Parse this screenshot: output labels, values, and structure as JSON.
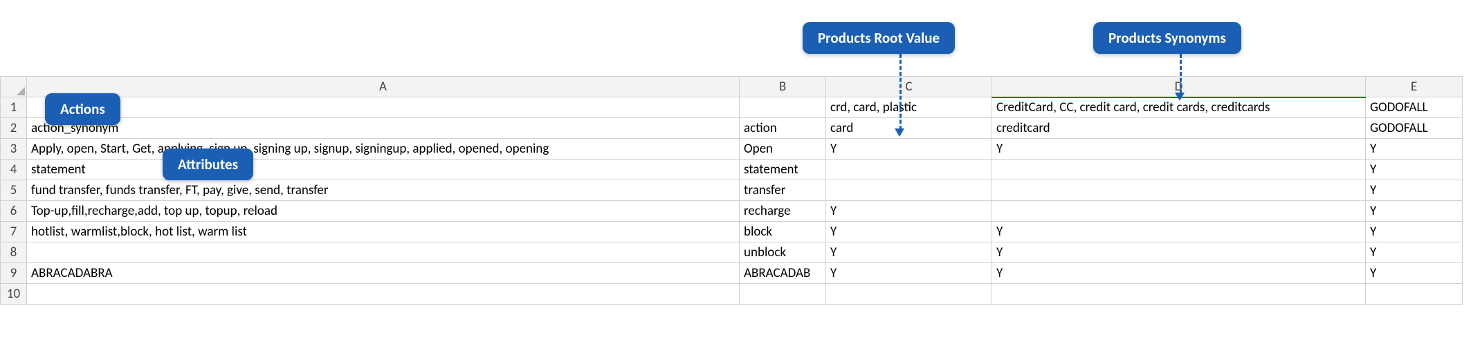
{
  "callouts": {
    "root": "Products Root Value",
    "synonyms": "Products Synonyms",
    "actions": "Actions",
    "attributes": "Attributes"
  },
  "columns": [
    "",
    "A",
    "B",
    "C",
    "D",
    "E"
  ],
  "row_labels": [
    "1",
    "2",
    "3",
    "4",
    "5",
    "6",
    "7",
    "8",
    "9",
    "10"
  ],
  "rows": [
    {
      "A": "",
      "B": "",
      "C": "crd, card, plastic",
      "D": "CreditCard, CC, credit card, credit cards, creditcards",
      "E": "GODOFALL"
    },
    {
      "A": "action_synonym",
      "B": "action",
      "C": "card",
      "D": "creditcard",
      "E": "GODOFALL"
    },
    {
      "A": "Apply, open,  Start, Get, applying, sign up, signing up, signup, signingup, applied, opened, opening",
      "B": "Open",
      "C": "Y",
      "D": "Y",
      "E": "Y"
    },
    {
      "A": "statement",
      "B": "statement",
      "C": "",
      "D": "",
      "E": "Y"
    },
    {
      "A": "fund transfer, funds transfer, FT, pay, give, send, transfer",
      "B": "transfer",
      "C": "",
      "D": "",
      "E": "Y"
    },
    {
      "A": "Top-up,fill,recharge,add, top up, topup, reload",
      "B": "recharge",
      "C": "Y",
      "D": "",
      "E": "Y"
    },
    {
      "A": "hotlist, warmlist,block, hot list, warm list",
      "B": "block",
      "C": "Y",
      "D": "Y",
      "E": "Y"
    },
    {
      "A": "",
      "B": "unblock",
      "C": "Y",
      "D": "Y",
      "E": "Y"
    },
    {
      "A": "ABRACADABRA",
      "B": "ABRACADAB",
      "C": "Y",
      "D": "Y",
      "E": "Y"
    },
    {
      "A": "",
      "B": "",
      "C": "",
      "D": "",
      "E": ""
    }
  ]
}
